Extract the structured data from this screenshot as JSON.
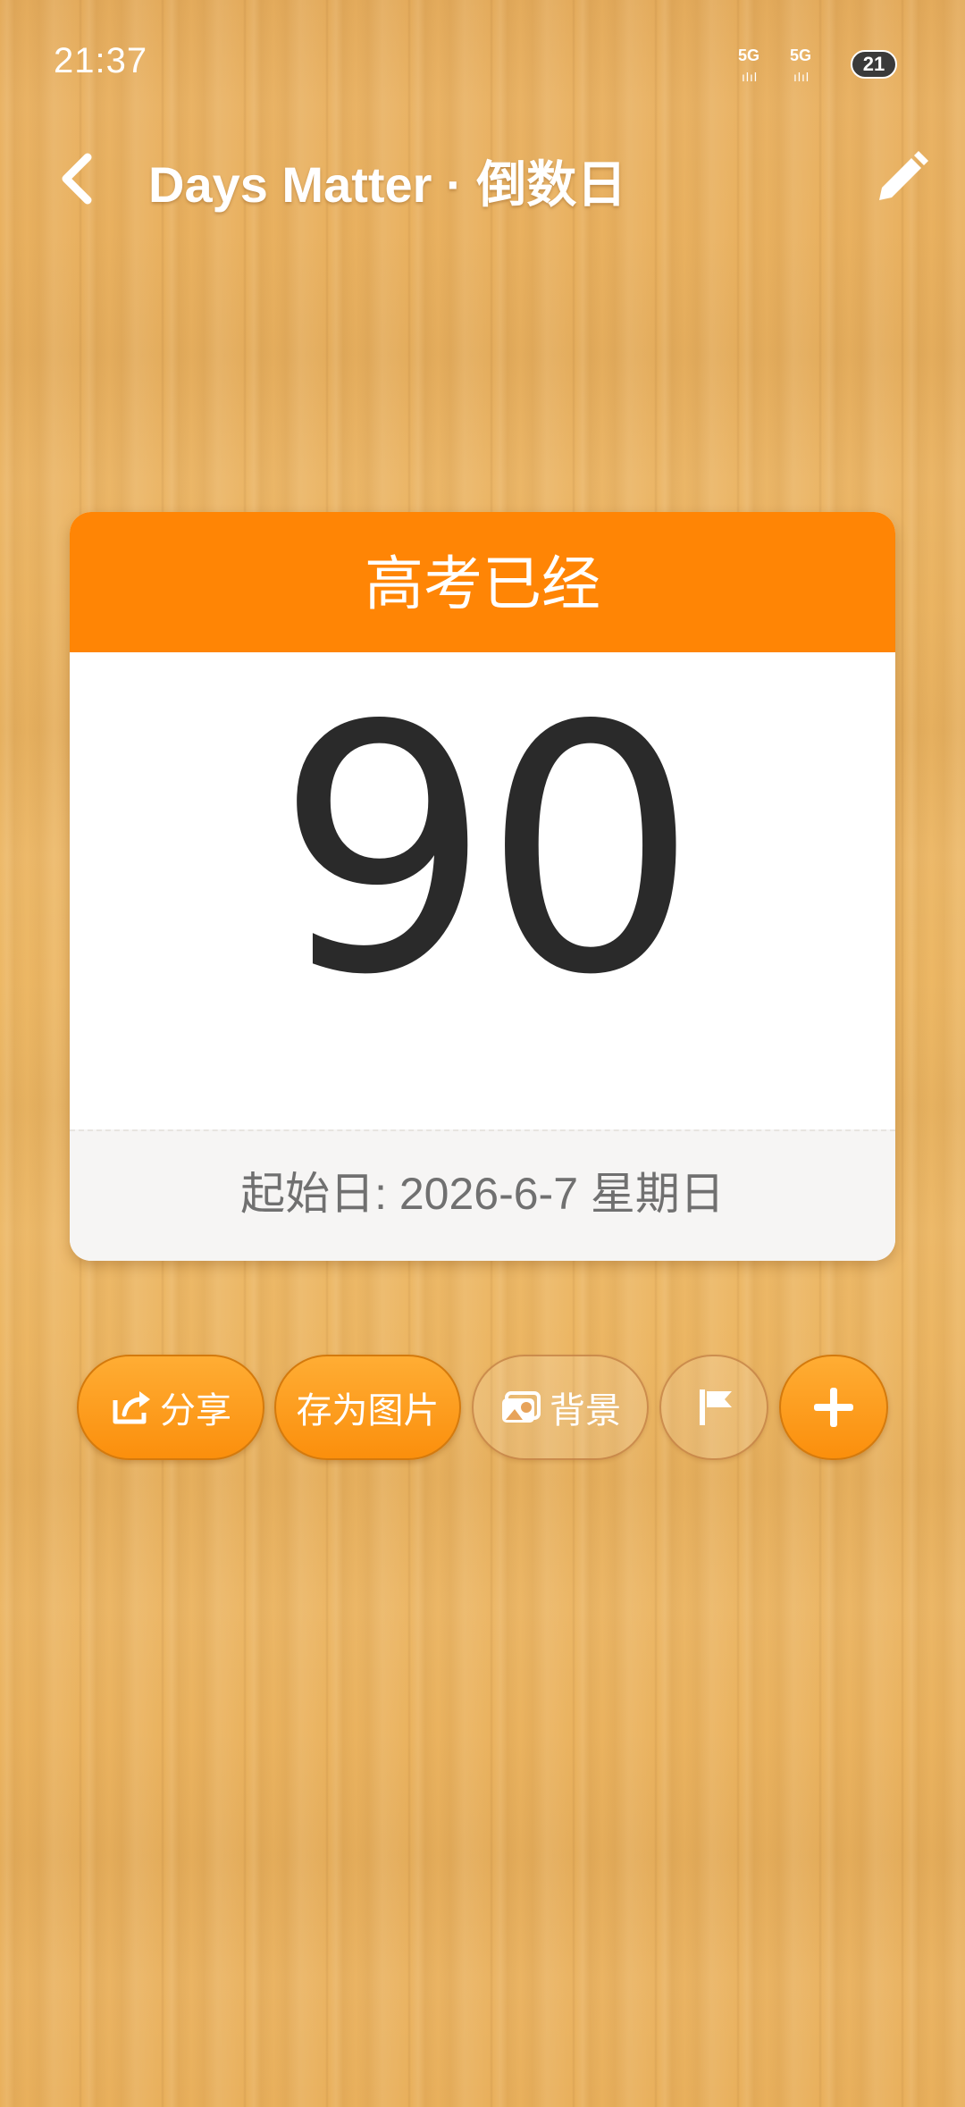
{
  "status_bar": {
    "time": "21:37",
    "sim1_network": "5G",
    "sim2_network": "5G",
    "signal_bars": "ılıl",
    "battery_level": "21"
  },
  "header": {
    "title": "Days Matter · 倒数日",
    "back_icon": "chevron-left-icon",
    "edit_icon": "pencil-icon"
  },
  "card": {
    "event_title": "高考已经",
    "days": "90",
    "start_date": "起始日: 2026-6-7 星期日",
    "header_color": "#ff8505"
  },
  "actions": {
    "share_label": "分享",
    "share_icon": "share-icon",
    "save_image_label": "存为图片",
    "background_label": "背景",
    "background_icon": "image-icon",
    "flag_icon": "flag-icon",
    "add_icon": "plus-icon",
    "accent_color": "#fb8f0c"
  }
}
